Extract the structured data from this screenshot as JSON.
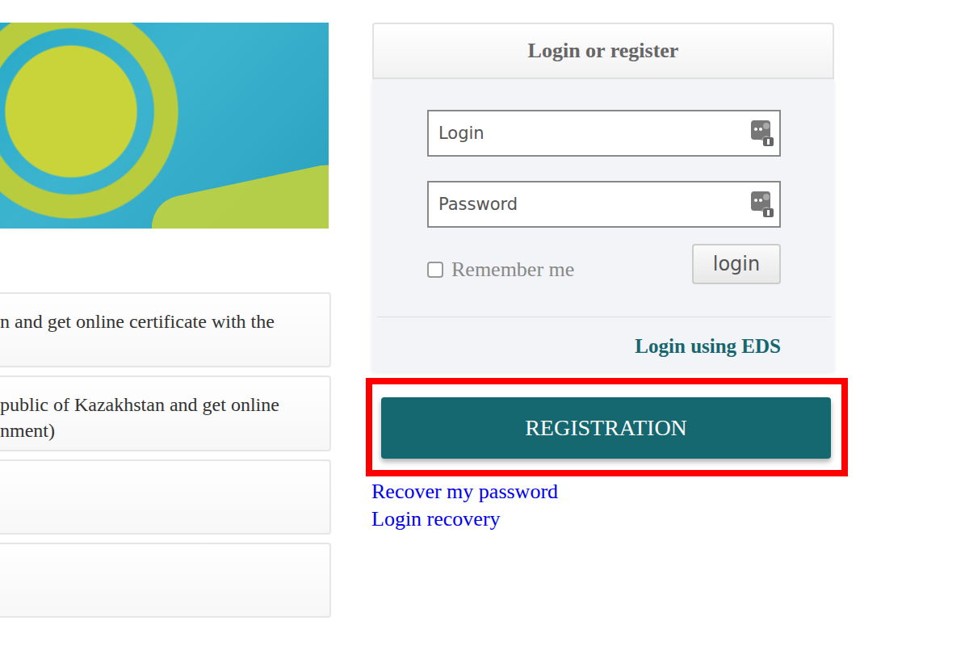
{
  "info_cards": [
    {
      "lines": [
        "n and get online certificate with the"
      ]
    },
    {
      "lines": [
        "public of Kazakhstan and get online",
        "nment)"
      ]
    },
    {
      "lines": []
    },
    {
      "lines": []
    }
  ],
  "login_panel": {
    "title": "Login or register",
    "fields": [
      {
        "placeholder": "Login"
      },
      {
        "placeholder": "Password"
      }
    ],
    "remember": {
      "label": "Remember me",
      "checked": false
    },
    "login_button": "login",
    "eds_link": "Login using EDS"
  },
  "registration": {
    "label": "REGISTRATION",
    "highlighted": true
  },
  "links": [
    "Recover my password",
    "Login recovery"
  ]
}
